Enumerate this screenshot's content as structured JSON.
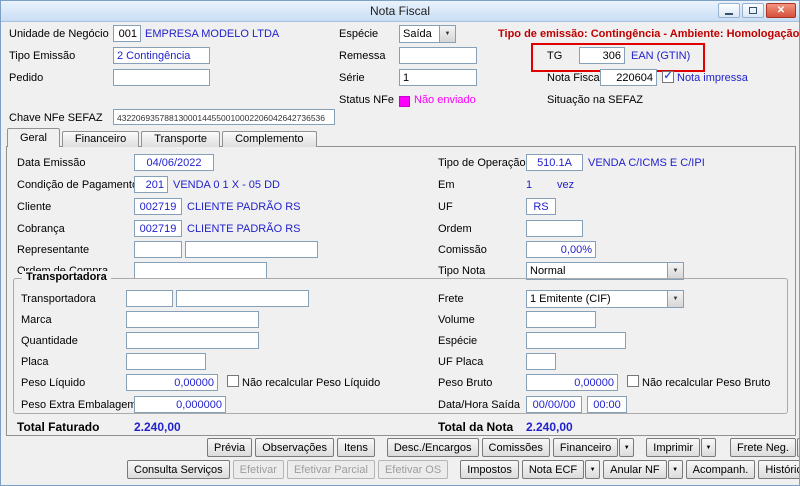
{
  "window": {
    "title": "Nota Fiscal"
  },
  "icons": {
    "dropdown_arrow": "▼",
    "check": "✓",
    "close": "✕"
  },
  "colors": {
    "value_text": "#2222cc",
    "warning_text": "#c00000",
    "status_nfe": "#ff00ff",
    "tg_highlight": "#e00000"
  },
  "header": {
    "unidade": {
      "label": "Unidade de Negócio",
      "code": "001",
      "name": "EMPRESA MODELO LTDA"
    },
    "especie": {
      "label": "Espécie",
      "value": "Saída"
    },
    "warning": "Tipo de emissão: Contingência - Ambiente: Homologação",
    "tipo_emissao": {
      "label": "Tipo Emissão",
      "value": "2 Contingência"
    },
    "remessa": {
      "label": "Remessa",
      "value": ""
    },
    "tg": {
      "label": "TG",
      "code": "306",
      "desc": "EAN (GTIN)"
    },
    "pedido": {
      "label": "Pedido",
      "value": ""
    },
    "serie": {
      "label": "Série",
      "value": "1"
    },
    "nota_fiscal": {
      "label": "Nota Fiscal",
      "value": "220604"
    },
    "nota_impressa_label": "Nota impressa",
    "nota_impressa_checked": true,
    "status_nfe": {
      "label": "Status NFe",
      "value": "Não enviado"
    },
    "situacao_sefaz_label": "Situação na SEFAZ",
    "chave": {
      "label": "Chave NFe SEFAZ",
      "value": "43220693578813000144550010002206042642736536"
    }
  },
  "tabs": {
    "geral": "Geral",
    "financeiro": "Financeiro",
    "transporte": "Transporte",
    "complemento": "Complemento",
    "active": "Geral"
  },
  "geral": {
    "data_emissao": {
      "label": "Data Emissão",
      "value": "04/06/2022"
    },
    "cond_pagamento": {
      "label": "Condição de Pagamento",
      "code": "201",
      "desc": "VENDA 0 1 X - 05 DD"
    },
    "cliente": {
      "label": "Cliente",
      "code": "002719",
      "desc": "CLIENTE PADRÃO RS"
    },
    "cobranca": {
      "label": "Cobrança",
      "code": "002719",
      "desc": "CLIENTE PADRÃO RS"
    },
    "representante": {
      "label": "Representante",
      "code": "",
      "desc": ""
    },
    "ordem_compra": {
      "label": "Ordem de Compra",
      "value": ""
    },
    "tipo_operacao": {
      "label": "Tipo de Operação",
      "code": "510.1A",
      "desc": "VENDA C/ICMS E C/IPI"
    },
    "em": {
      "label": "Em",
      "value": "1",
      "suffix": "vez"
    },
    "uf": {
      "label": "UF",
      "value": "RS"
    },
    "ordem": {
      "label": "Ordem",
      "value": ""
    },
    "comissao": {
      "label": "Comissão",
      "value": "0,00%"
    },
    "tipo_nota": {
      "label": "Tipo Nota",
      "value": "Normal"
    }
  },
  "transportadora": {
    "legend": "Transportadora",
    "transportadora": {
      "label": "Transportadora",
      "code": "",
      "desc": ""
    },
    "frete": {
      "label": "Frete",
      "value": "1 Emitente (CIF)"
    },
    "marca": {
      "label": "Marca",
      "value": ""
    },
    "volume": {
      "label": "Volume",
      "value": ""
    },
    "quantidade": {
      "label": "Quantidade",
      "value": ""
    },
    "especie": {
      "label": "Espécie",
      "value": ""
    },
    "placa": {
      "label": "Placa",
      "value": ""
    },
    "uf_placa": {
      "label": "UF Placa",
      "value": ""
    },
    "peso_liquido": {
      "label": "Peso Líquido",
      "value": "0,00000",
      "check_label": "Não recalcular Peso Líquido",
      "check_checked": false
    },
    "peso_bruto": {
      "label": "Peso Bruto",
      "value": "0,00000",
      "check_label": "Não recalcular Peso Bruto",
      "check_checked": false
    },
    "peso_extra": {
      "label": "Peso Extra Embalagem",
      "value": "0,000000"
    },
    "data_hora_saida": {
      "label": "Data/Hora Saída",
      "date": "00/00/00",
      "time": "00:00"
    }
  },
  "totals": {
    "faturado_label": "Total Faturado",
    "faturado_value": "2.240,00",
    "nota_label": "Total da Nota",
    "nota_value": "2.240,00"
  },
  "actions": {
    "row1": [
      {
        "label": "Prévia"
      },
      {
        "label": "Observações"
      },
      {
        "label": "Itens"
      },
      {
        "label": "Desc./Encargos"
      },
      {
        "label": "Comissões"
      },
      {
        "label": "Financeiro",
        "dropdown": true
      },
      {
        "label": "Imprimir",
        "dropdown": true
      },
      {
        "label": "Frete Neg.",
        "dropdown": true
      }
    ],
    "row2": [
      {
        "label": "Consulta Serviços"
      },
      {
        "label": "Efetivar",
        "disabled": true
      },
      {
        "label": "Efetivar Parcial",
        "disabled": true
      },
      {
        "label": "Efetivar OS",
        "disabled": true
      },
      {
        "label": "Impostos"
      },
      {
        "label": "Nota ECF",
        "dropdown": true
      },
      {
        "label": "Anular NF",
        "dropdown": true
      },
      {
        "label": "Acompanh."
      },
      {
        "label": "Histórico",
        "dropdown": true
      }
    ]
  }
}
